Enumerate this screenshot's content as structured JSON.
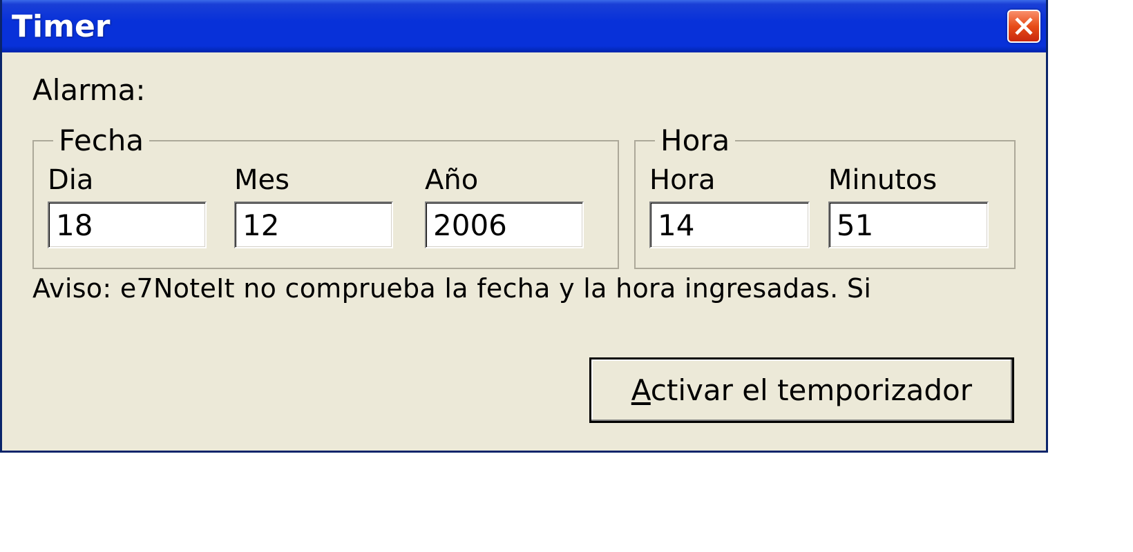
{
  "window": {
    "title": "Timer"
  },
  "content": {
    "alarm_label": "Alarma:",
    "fecha": {
      "legend": "Fecha",
      "dia_label": "Dia",
      "dia_value": "18",
      "mes_label": "Mes",
      "mes_value": "12",
      "ano_label": "Año",
      "ano_value": "2006"
    },
    "hora": {
      "legend": "Hora",
      "hora_label": "Hora",
      "hora_value": "14",
      "min_label": "Minutos",
      "min_value": "51"
    },
    "warning": "Aviso: e7NoteIt no comprueba la fecha y la hora ingresadas. Si",
    "activate_button_prefix": "A",
    "activate_button_rest": "ctivar el temporizador"
  }
}
